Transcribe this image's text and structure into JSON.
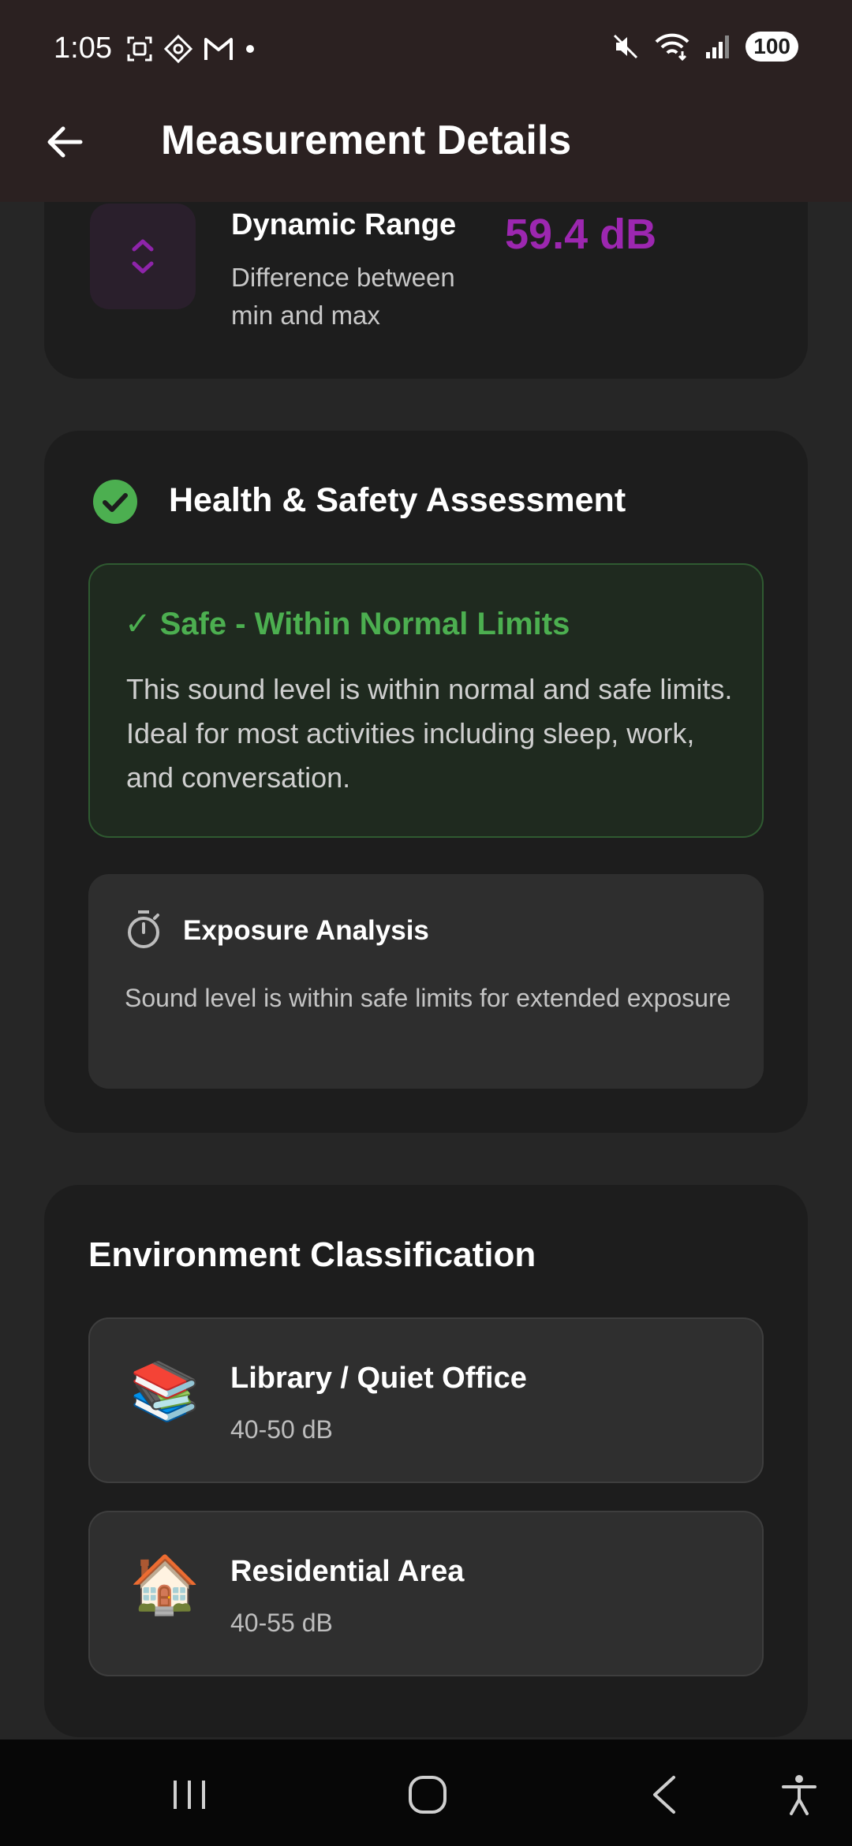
{
  "status_bar": {
    "time": "1:05",
    "battery": "100",
    "left_icons": [
      "screenshot-icon",
      "nav-diamond-icon",
      "gmail-icon",
      "dot-icon"
    ],
    "right_icons": [
      "mute-icon",
      "wifi-icon",
      "signal-icon"
    ]
  },
  "app_bar": {
    "title": "Measurement Details",
    "back_icon": "arrow-left-icon"
  },
  "dynamic_range": {
    "title": "Dynamic Range",
    "description": "Difference between min and max",
    "value": "59.4 dB",
    "icon": "unfold-icon",
    "accent_color": "#9c27b0"
  },
  "health": {
    "title": "Health & Safety Assessment",
    "status_title": "✓ Safe - Within Normal Limits",
    "status_text": "This sound level is within normal and safe limits. Ideal for most activities including sleep, work, and conversation.",
    "status_color": "#4caf50",
    "exposure_title": "Exposure Analysis",
    "exposure_text": "Sound level is within safe limits for extended exposure"
  },
  "environment": {
    "title": "Environment Classification",
    "items": [
      {
        "emoji": "📚",
        "name": "Library / Quiet Office",
        "range": "40-50 dB"
      },
      {
        "emoji": "🏠",
        "name": "Residential Area",
        "range": "40-55 dB"
      }
    ]
  },
  "nav_bar": {
    "buttons": [
      "recents-icon",
      "home-icon",
      "back-icon",
      "accessibility-icon"
    ]
  }
}
